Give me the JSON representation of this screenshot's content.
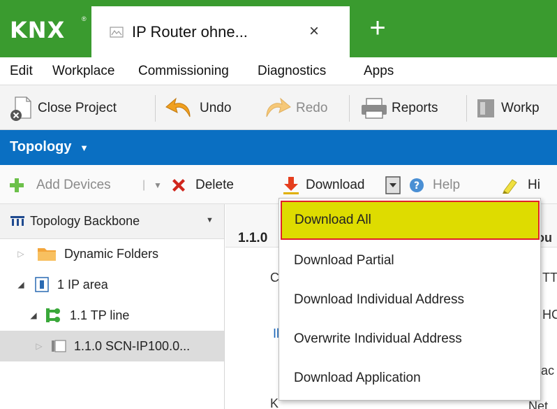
{
  "app": {
    "logo": "KNX",
    "logo_mark": "®",
    "tab_title": "IP Router ohne...",
    "tab_close": "×",
    "new_tab": "+"
  },
  "menubar": {
    "items": [
      "Edit",
      "Workplace",
      "Commissioning",
      "Diagnostics",
      "Apps"
    ]
  },
  "toolbar": {
    "close_project": "Close Project",
    "undo": "Undo",
    "redo": "Redo",
    "reports": "Reports",
    "workplace": "Workp"
  },
  "panel": {
    "title": "Topology",
    "caret": "▼",
    "add_devices": "Add Devices",
    "delete": "Delete",
    "download": "Download",
    "help": "Help",
    "highlight": "Hi"
  },
  "tree": {
    "header": "Topology Backbone",
    "items": [
      {
        "label": "Dynamic Folders",
        "icon": "folder-icon",
        "expander": "▷"
      },
      {
        "label": "1 IP area",
        "icon": "area-icon",
        "expander": "◢"
      },
      {
        "label": "1.1 TP line",
        "icon": "line-icon",
        "expander": "◢"
      },
      {
        "label": "1.1.0 SCN-IP100.0...",
        "icon": "device-icon",
        "expander": "▷"
      }
    ]
  },
  "content": {
    "title": "1.1.0",
    "fragments": [
      "C",
      "Il",
      "K",
      "ou",
      "TTR",
      "HC",
      "ac",
      "Net"
    ]
  },
  "dropdown": {
    "items": [
      "Download All",
      "Download Partial",
      "Download Individual Address",
      "Overwrite Individual Address",
      "Download Application"
    ]
  },
  "colors": {
    "title_bar": "#3a9b2f",
    "panel_header": "#0a6fc2",
    "highlight_fill": "#dedc00",
    "highlight_border": "#e0202a",
    "add_icon": "#6cc04a",
    "delete_icon": "#d0261c",
    "download_icon": "#e53e1e"
  }
}
